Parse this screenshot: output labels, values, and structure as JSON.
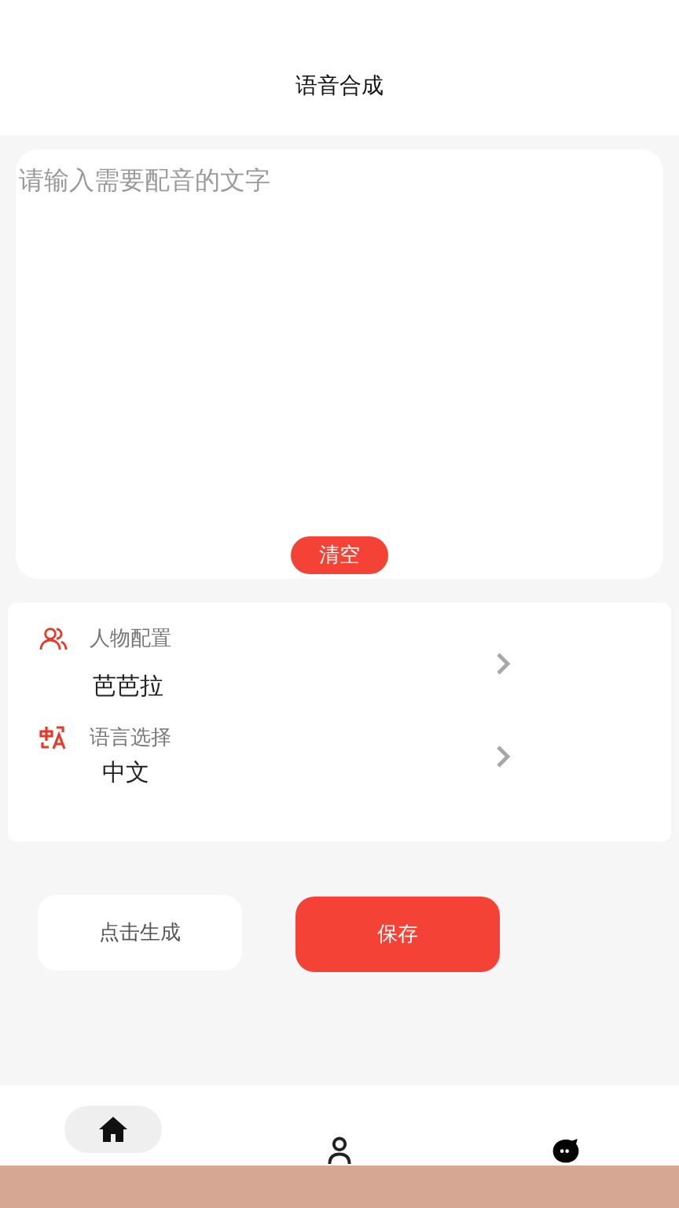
{
  "header": {
    "title": "语音合成"
  },
  "text_input": {
    "placeholder": "请输入需要配音的文字"
  },
  "clear_button": "清空",
  "settings": [
    {
      "kind": "person",
      "label": "人物配置",
      "value": "芭芭拉"
    },
    {
      "kind": "language",
      "label": "语言选择",
      "value": "中文"
    }
  ],
  "buttons": [
    {
      "kind": "secondary",
      "label": "点击生成"
    },
    {
      "kind": "primary",
      "label": "保存"
    }
  ],
  "tab_bar": [
    {
      "kind": "home",
      "selected": true
    },
    {
      "kind": "profile",
      "selected": false
    },
    {
      "kind": "chat",
      "selected": false
    }
  ]
}
